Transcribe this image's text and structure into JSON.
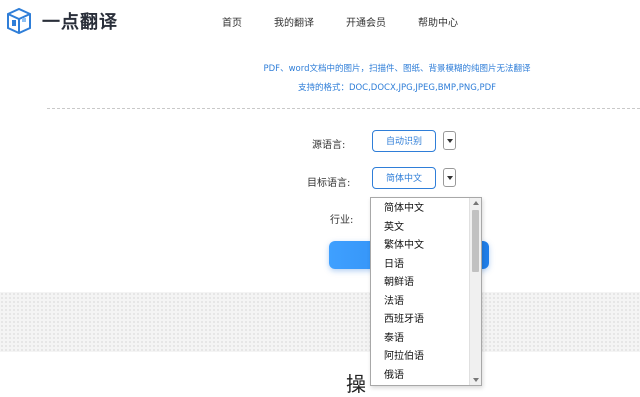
{
  "header": {
    "logo_text": "一点翻译",
    "nav": [
      "首页",
      "我的翻译",
      "开通会员",
      "帮助中心"
    ]
  },
  "notice": {
    "line1": "PDF、word文档中的图片，扫描件、图纸、背景模糊的纯图片无法翻译",
    "line2": "支持的格式：DOC,DOCX,JPG,JPEG,BMP,PNG,PDF"
  },
  "form": {
    "source_label": "源语言:",
    "source_value": "自动识别",
    "target_label": "目标语言:",
    "target_value": "简体中文",
    "industry_label": "行业:"
  },
  "dropdown": {
    "options": [
      "简体中文",
      "英文",
      "繁体中文",
      "日语",
      "朝鲜语",
      "法语",
      "西班牙语",
      "泰语",
      "阿拉伯语",
      "俄语"
    ]
  },
  "section": {
    "heading_partial": "操"
  },
  "colors": {
    "accent": "#2f7ed8",
    "button_gradient_start": "#3fa0ff",
    "button_gradient_end": "#1f7de8"
  }
}
